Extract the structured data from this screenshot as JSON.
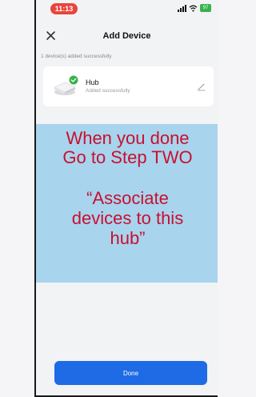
{
  "status_bar": {
    "time": "11:13",
    "battery": "97"
  },
  "nav": {
    "title": "Add Device"
  },
  "summary": "1 device(s) added successfully",
  "device": {
    "name": "Hub",
    "status": "Added successfully"
  },
  "overlay": {
    "line1": "When you done",
    "line2": "Go to Step TWO",
    "quote": "“Associate\ndevices to this\nhub”"
  },
  "done_button": {
    "label": "Done"
  },
  "colors": {
    "accent": "#1f6be6",
    "overlay_bg": "#a8d4ee",
    "overlay_text": "#c8102e",
    "success": "#38b24a",
    "time_pill": "#e8453c"
  }
}
